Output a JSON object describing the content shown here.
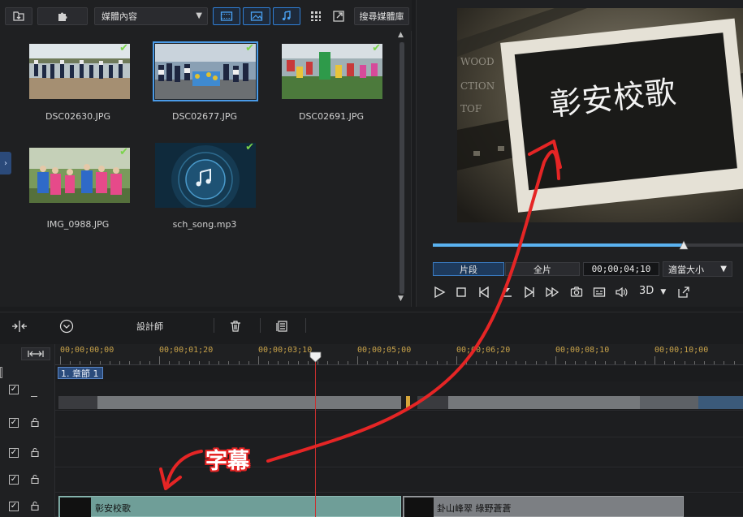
{
  "library": {
    "content_select": "媒體內容",
    "search_button": "搜尋媒體庫",
    "items": [
      {
        "label": "DSC02630.JPG"
      },
      {
        "label": "DSC02677.JPG"
      },
      {
        "label": "DSC02691.JPG"
      },
      {
        "label": "IMG_0988.JPG"
      },
      {
        "label": "sch_song.mp3"
      }
    ]
  },
  "preview": {
    "title_text": "彰安校歌",
    "tab_clip": "片段",
    "tab_full": "全片",
    "timecode": "00;00;04;10",
    "zoom": "適當大小",
    "mode_3d": "3D",
    "progress": 0.81
  },
  "timeline": {
    "designer_label": "設計師",
    "ruler": [
      "00;00;00;00",
      "00;00;01;20",
      "00;00;03;10",
      "00;00;05;00",
      "00;00;06;20",
      "00;00;08;10",
      "00;00;10;00"
    ],
    "chapter": "1. 章節 1",
    "title_clip_1": "彰安校歌",
    "title_clip_2": "卦山峰翠 綠野蒼蒼"
  },
  "annotation": {
    "label": "字幕",
    "color": "#e52525"
  }
}
